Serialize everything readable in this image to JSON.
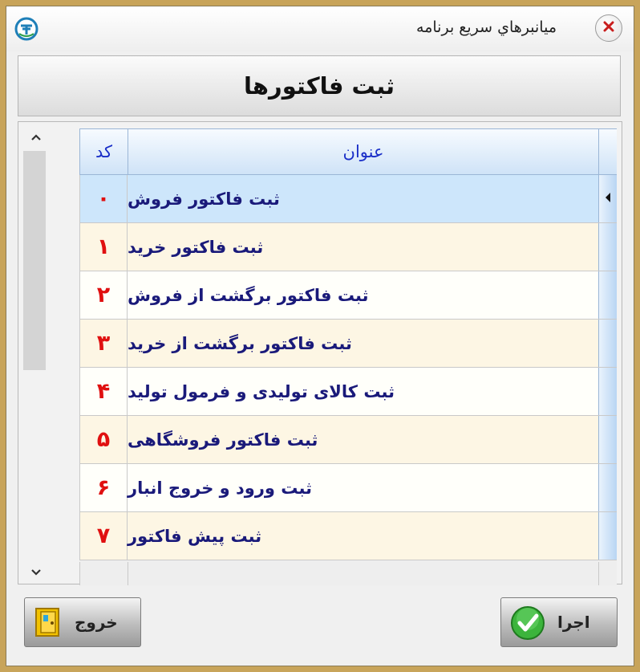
{
  "window": {
    "title": "ميانبرهاي سريع برنامه",
    "header_title": "ثبت فاکتورها"
  },
  "grid": {
    "columns": {
      "code": "کد",
      "title": "عنوان"
    },
    "rows": [
      {
        "code": "۰",
        "title": "ثبت فاکتور فروش"
      },
      {
        "code": "۱",
        "title": "ثبت فاکتور خرید"
      },
      {
        "code": "۲",
        "title": "ثبت فاکتور برگشت از فروش"
      },
      {
        "code": "۳",
        "title": "ثبت فاکتور برگشت از خرید"
      },
      {
        "code": "۴",
        "title": "ثبت کالای تولیدی و فرمول تولید"
      },
      {
        "code": "۵",
        "title": "ثبت فاکتور فروشگاهی"
      },
      {
        "code": "۶",
        "title": "ثبت ورود و خروج انبار"
      },
      {
        "code": "۷",
        "title": "ثبت پیش فاکتور"
      }
    ],
    "selected_row": 0
  },
  "buttons": {
    "exit_label": "خروج",
    "run_label": "اجرا"
  },
  "icons": {
    "app": "app-logo-icon",
    "close": "close-icon",
    "scroll_up": "chevron-up-icon",
    "scroll_down": "chevron-down-icon",
    "row_indicator": "row-pointer-icon",
    "exit": "exit-door-icon",
    "run": "checkmark-icon"
  },
  "colors": {
    "code_text": "#e01010",
    "title_text": "#1a1a7a",
    "header_text": "#1a2fc8",
    "selected_row": "#cde6fb"
  }
}
